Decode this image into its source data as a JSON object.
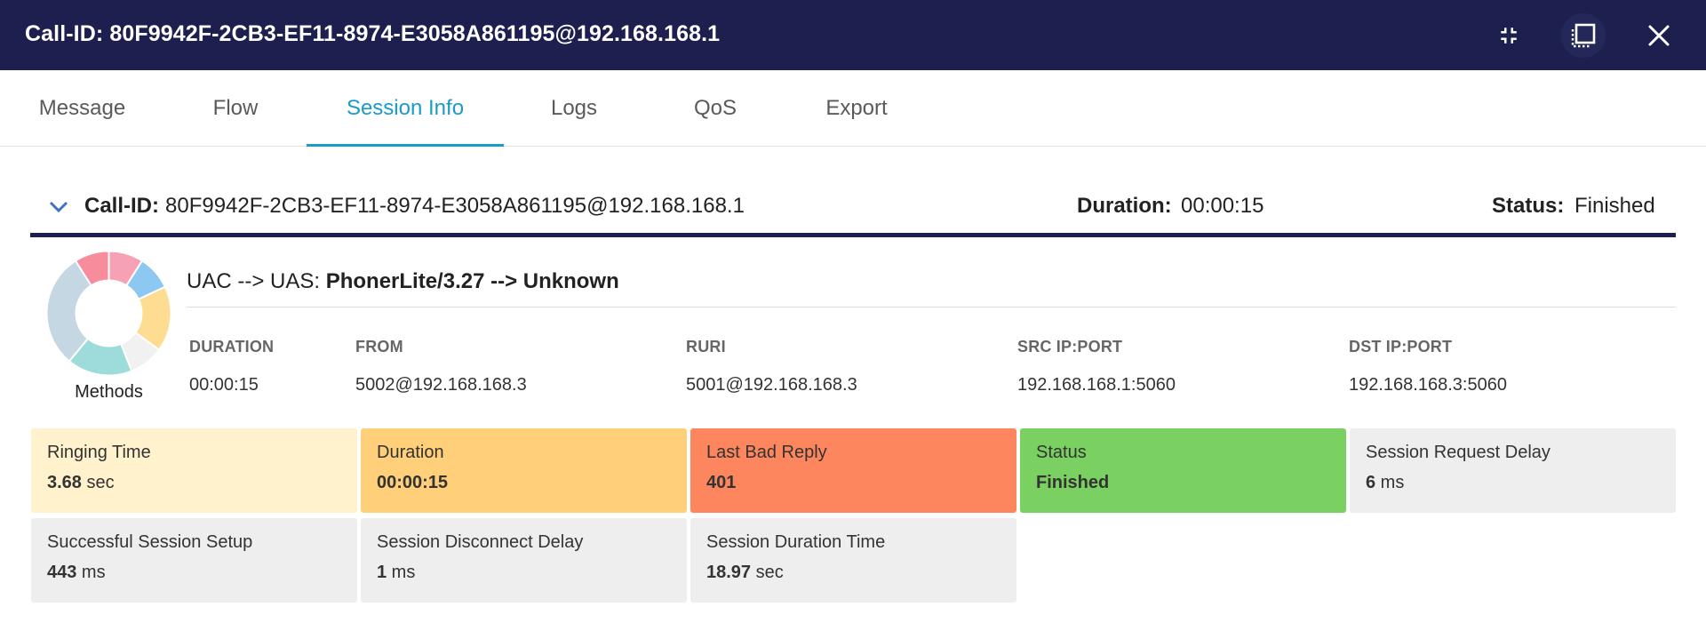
{
  "window": {
    "title": "Call-ID: 80F9942F-2CB3-EF11-8974-E3058A861195@192.168.168.1",
    "buttons": [
      {
        "name": "collapse-icon"
      },
      {
        "name": "restore-window-icon"
      },
      {
        "name": "close-icon"
      }
    ]
  },
  "tabs": [
    {
      "label": "Message",
      "active": false
    },
    {
      "label": "Flow",
      "active": false
    },
    {
      "label": "Session Info",
      "active": true
    },
    {
      "label": "Logs",
      "active": false
    },
    {
      "label": "QoS",
      "active": false
    },
    {
      "label": "Export",
      "active": false
    }
  ],
  "header": {
    "call_id_label": "Call-ID:",
    "call_id_value": "80F9942F-2CB3-EF11-8974-E3058A861195@192.168.168.1",
    "duration_label": "Duration:",
    "duration_value": "00:00:15",
    "status_label": "Status:",
    "status_value": "Finished"
  },
  "methods_chart": {
    "label": "Methods",
    "segments": [
      {
        "fraction": 0.09,
        "color": "#f7a1b5"
      },
      {
        "fraction": 0.09,
        "color": "#8cc8f2"
      },
      {
        "fraction": 0.17,
        "color": "#fedc91"
      },
      {
        "fraction": 0.09,
        "color": "#f1f1f1"
      },
      {
        "fraction": 0.17,
        "color": "#9edcdc"
      },
      {
        "fraction": 0.3,
        "color": "#c5d7e3"
      },
      {
        "fraction": 0.09,
        "color": "#f78c9c"
      }
    ]
  },
  "session": {
    "prefix": "UAC --> UAS: ",
    "agents": "PhonerLite/3.27 --> Unknown",
    "columns": [
      {
        "label": "DURATION",
        "value": "00:00:15"
      },
      {
        "label": "FROM",
        "value": "5002@192.168.168.3"
      },
      {
        "label": "RURI",
        "value": "5001@192.168.168.3"
      },
      {
        "label": "SRC IP:PORT",
        "value": "192.168.168.1:5060"
      },
      {
        "label": "DST IP:PORT",
        "value": "192.168.168.3:5060"
      }
    ]
  },
  "cards": [
    {
      "label": "Ringing Time",
      "value": "3.68",
      "unit": " sec",
      "color": "#fff2cc"
    },
    {
      "label": "Duration",
      "value": "00:00:15",
      "unit": "",
      "color": "#ffcf7a"
    },
    {
      "label": "Last Bad Reply",
      "value": "401",
      "unit": "",
      "color": "#fe865f"
    },
    {
      "label": "Status",
      "value": "Finished",
      "unit": "",
      "color": "#7ad060"
    },
    {
      "label": "Session Request Delay",
      "value": "6",
      "unit": " ms",
      "color": "#eeeeee"
    },
    {
      "label": "Successful Session Setup",
      "value": "443",
      "unit": " ms",
      "color": "#eeeeee"
    },
    {
      "label": "Session Disconnect Delay",
      "value": "1",
      "unit": " ms",
      "color": "#eeeeee"
    },
    {
      "label": "Session Duration Time",
      "value": "18.97",
      "unit": " sec",
      "color": "#eeeeee"
    }
  ]
}
